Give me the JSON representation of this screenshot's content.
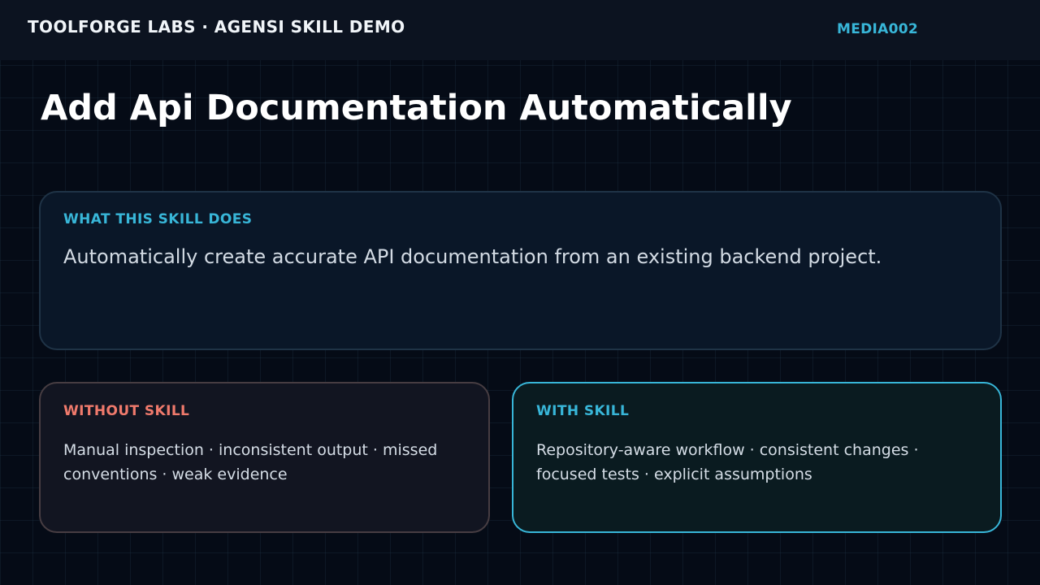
{
  "header": {
    "brand": "TOOLFORGE LABS · AGENSI SKILL DEMO",
    "media_id": "MEDIA002"
  },
  "title": "Add Api Documentation Automatically",
  "what": {
    "label": "WHAT THIS SKILL DOES",
    "text": "Automatically create accurate API documentation from an existing backend project."
  },
  "without": {
    "label": "WITHOUT SKILL",
    "text": "Manual inspection · inconsistent output · missed conventions · weak evidence"
  },
  "with": {
    "label": "WITH SKILL",
    "text": "Repository-aware workflow · consistent changes · focused tests · explicit assumptions"
  },
  "colors": {
    "accent": "#38b6d8",
    "negative": "#f07a6c",
    "background": "#050b16",
    "header_background": "#0c1320"
  }
}
